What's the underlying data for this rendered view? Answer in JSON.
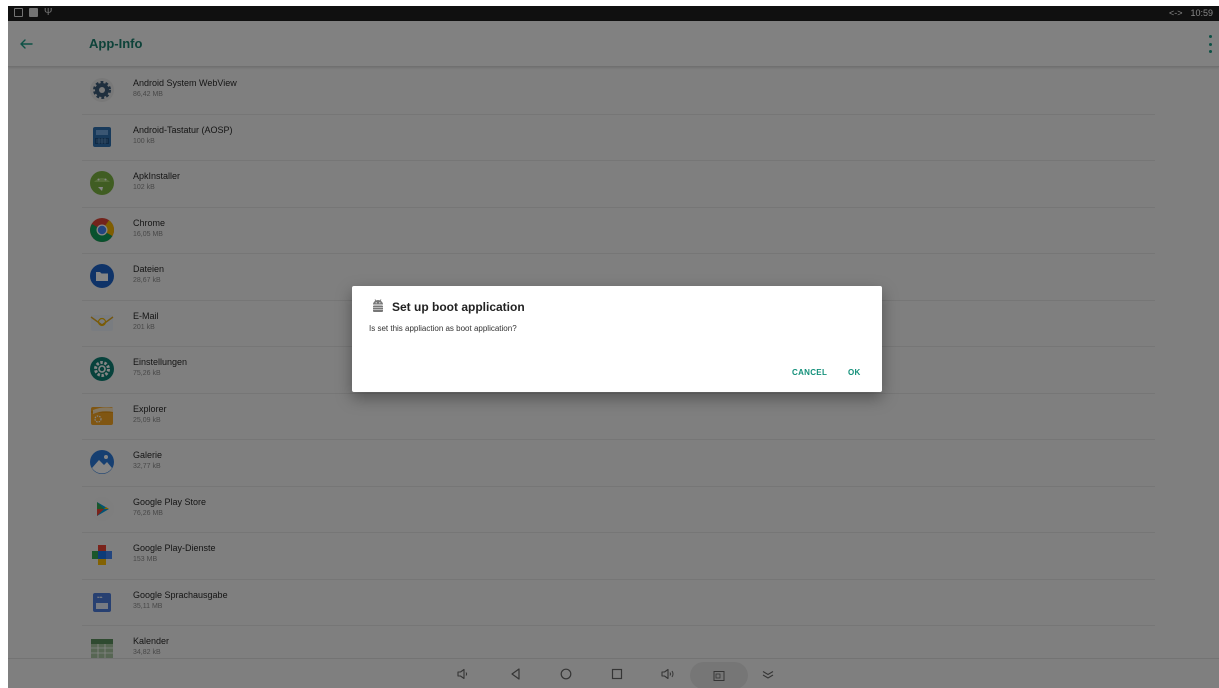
{
  "status_bar": {
    "time": "10:59",
    "left_icons": [
      "window-icon",
      "image-icon",
      "usb-icon"
    ],
    "right_icons": [
      "transfer-arrows-icon"
    ]
  },
  "app_bar": {
    "title": "App-Info"
  },
  "apps": [
    {
      "name": "Android System WebView",
      "size": "86,42 MB",
      "icon": "webview-gear-icon"
    },
    {
      "name": "Android-Tastatur (AOSP)",
      "size": "100 kB",
      "icon": "keyboard-icon"
    },
    {
      "name": "ApkInstaller",
      "size": "102 kB",
      "icon": "android-installer-icon"
    },
    {
      "name": "Chrome",
      "size": "16,05 MB",
      "icon": "chrome-icon"
    },
    {
      "name": "Dateien",
      "size": "28,67 kB",
      "icon": "files-folder-icon"
    },
    {
      "name": "E-Mail",
      "size": "201 kB",
      "icon": "email-icon"
    },
    {
      "name": "Einstellungen",
      "size": "75,26 kB",
      "icon": "settings-gear-icon"
    },
    {
      "name": "Explorer",
      "size": "25,09 kB",
      "icon": "explorer-folder-icon"
    },
    {
      "name": "Galerie",
      "size": "32,77 kB",
      "icon": "gallery-icon"
    },
    {
      "name": "Google Play Store",
      "size": "76,26 MB",
      "icon": "play-store-icon"
    },
    {
      "name": "Google Play-Dienste",
      "size": "153 MB",
      "icon": "play-services-icon"
    },
    {
      "name": "Google Sprachausgabe",
      "size": "35,11 MB",
      "icon": "text-to-speech-icon"
    },
    {
      "name": "Kalender",
      "size": "34,82 kB",
      "icon": "calendar-icon"
    }
  ],
  "dialog": {
    "title": "Set up boot application",
    "message": "Is set this appliaction as boot application?",
    "cancel_label": "CANCEL",
    "ok_label": "OK",
    "accent": "#13907a"
  },
  "colors": {
    "accent": "#1a7f6e",
    "scrim": "rgba(0,0,0,0.48)"
  }
}
